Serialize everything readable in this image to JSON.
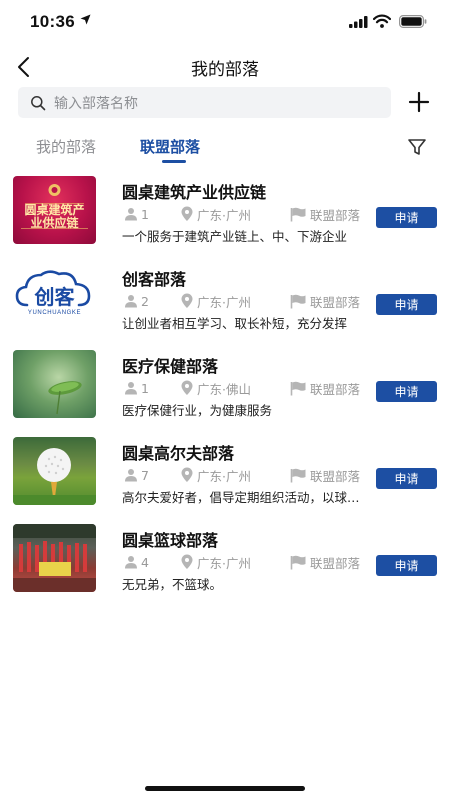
{
  "status_bar": {
    "time": "10:36"
  },
  "header": {
    "title": "我的部落"
  },
  "search": {
    "placeholder": "输入部落名称"
  },
  "tabs": [
    {
      "label": "我的部落",
      "active": false
    },
    {
      "label": "联盟部落",
      "active": true
    }
  ],
  "tribes": [
    {
      "name": "圆桌建筑产业供应链",
      "members": "1",
      "location": "广东·广州",
      "type": "联盟部落",
      "description": "一个服务于建筑产业链上、中、下游企业",
      "action": "申请",
      "thumb_text": "圆桌建筑产业供应链"
    },
    {
      "name": "创客部落",
      "members": "2",
      "location": "广东·广州",
      "type": "联盟部落",
      "description": "让创业者相互学习、取长补短，充分发挥",
      "action": "申请",
      "thumb_text": "创客",
      "thumb_subtext": "YUNCHUANGKE"
    },
    {
      "name": "医疗保健部落",
      "members": "1",
      "location": "广东·佛山",
      "type": "联盟部落",
      "description": "医疗保健行业，为健康服务",
      "action": "申请"
    },
    {
      "name": "圆桌高尔夫部落",
      "members": "7",
      "location": "广东·广州",
      "type": "联盟部落",
      "description": "高尔夫爱好者，倡导定期组织活动，以球会友",
      "action": "申请"
    },
    {
      "name": "圆桌篮球部落",
      "members": "4",
      "location": "广东·广州",
      "type": "联盟部落",
      "description": "无兄弟，不篮球。",
      "action": "申请"
    }
  ],
  "colors": {
    "accent": "#1d4fa3",
    "muted": "#9a9a9a"
  }
}
